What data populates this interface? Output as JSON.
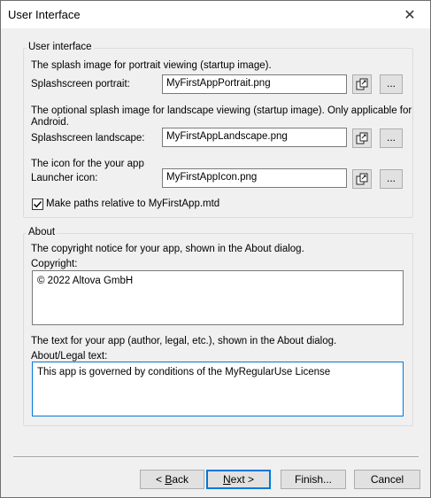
{
  "window": {
    "title": "User Interface",
    "close_symbol": "✕"
  },
  "user_interface": {
    "legend": "User interface",
    "portrait_desc": "The splash image for portrait viewing (startup image).",
    "portrait_label": "Splashscreen portrait:",
    "portrait_value": "MyFirstAppPortrait.png",
    "landscape_desc_line1": "The optional splash image for landscape viewing (startup image). Only applicable for",
    "landscape_desc_line2": "Android.",
    "landscape_label": "Splashscreen landscape:",
    "landscape_value": "MyFirstAppLandscape.png",
    "icon_desc": "The icon for the your app",
    "icon_label": "Launcher icon:",
    "icon_value": "MyFirstAppIcon.png",
    "browse_label": "...",
    "relative_paths_label": "Make paths relative to MyFirstApp.mtd",
    "relative_paths_checked": true
  },
  "about": {
    "legend": "About",
    "copyright_desc": "The copyright notice for your app, shown in the About dialog.",
    "copyright_label": "Copyright:",
    "copyright_value": "© 2022 Altova GmbH",
    "legal_desc": "The text for your app (author, legal, etc.), shown in the About dialog.",
    "legal_label": "About/Legal text:",
    "legal_value": "This app is governed by conditions of the MyRegularUse License"
  },
  "buttons": {
    "back_prefix": "< ",
    "back_mnemonic": "B",
    "back_rest": "ack",
    "next_mnemonic": "N",
    "next_rest": "ext >",
    "finish": "Finish...",
    "cancel": "Cancel"
  },
  "icons": {
    "edit_icon": "edit-copy-icon",
    "check_icon": "checkmark-icon",
    "close_icon": "close-icon"
  }
}
